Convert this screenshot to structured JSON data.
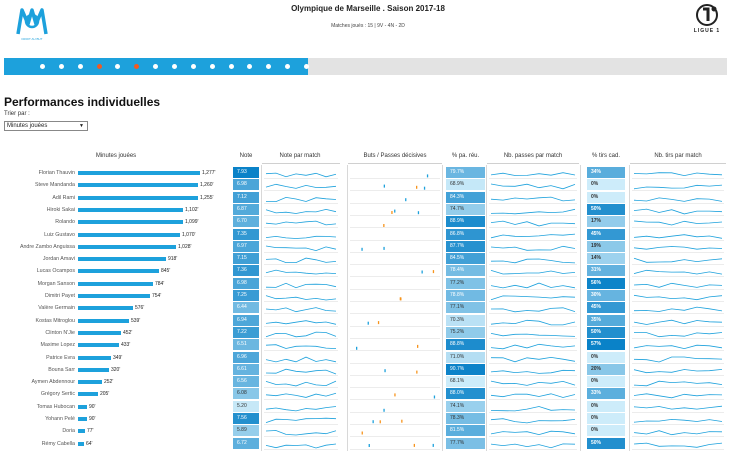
{
  "header": {
    "title": "Olympique de Marseille . Saison 2017-18",
    "subtitle": "Matches joués : 15 | 9V - 4N - 2D"
  },
  "logos": {
    "club_text": "DROIT AU BUT",
    "league_text": "LIGUE 1"
  },
  "slider": {
    "progress_fraction": 0.42,
    "dots": [
      "normal",
      "normal",
      "normal",
      "red",
      "normal",
      "red",
      "normal",
      "normal",
      "normal",
      "normal",
      "normal",
      "normal",
      "normal",
      "normal",
      "normal"
    ]
  },
  "section": {
    "title": "Performances individuelles",
    "sort_label": "Trier par :",
    "sort_value": "Minutes jouées"
  },
  "columns": {
    "minutes": "Minutes jouées",
    "note": "Note",
    "note_per_match": "Note par match",
    "goals_assists": "Buts / Passes décisives",
    "pass_pct": "% pa. réu.",
    "passes_per_match": "Nb. passes par match",
    "shots_pct": "% tirs cad.",
    "shots_per_match": "Nb. tirs par match"
  },
  "colors": {
    "accent": "#1da1dc",
    "slider_track": "#e3e3e3",
    "dot_red": "#f15a22"
  },
  "players": [
    {
      "name": "Florian Thauvin",
      "minutes": 1277,
      "minutes_label": "1,277'",
      "note": "7.93",
      "pass_pct": "79.7%",
      "pass_val": 79.7,
      "shots_pct": "34%",
      "shots_val": 34
    },
    {
      "name": "Steve Mandanda",
      "minutes": 1260,
      "minutes_label": "1,260'",
      "note": "6.98",
      "pass_pct": "68.9%",
      "pass_val": 68.9,
      "shots_pct": "0%",
      "shots_val": 0
    },
    {
      "name": "Adil Rami",
      "minutes": 1255,
      "minutes_label": "1,255'",
      "note": "7.12",
      "pass_pct": "84.3%",
      "pass_val": 84.3,
      "shots_pct": "0%",
      "shots_val": 0
    },
    {
      "name": "Hiroki Sakai",
      "minutes": 1102,
      "minutes_label": "1,102'",
      "note": "6.87",
      "pass_pct": "74.7%",
      "pass_val": 74.7,
      "shots_pct": "50%",
      "shots_val": 50
    },
    {
      "name": "Rolando",
      "minutes": 1099,
      "minutes_label": "1,099'",
      "note": "6.70",
      "pass_pct": "88.9%",
      "pass_val": 88.9,
      "shots_pct": "17%",
      "shots_val": 17
    },
    {
      "name": "Luiz Gustavo",
      "minutes": 1070,
      "minutes_label": "1,070'",
      "note": "7.35",
      "pass_pct": "86.8%",
      "pass_val": 86.8,
      "shots_pct": "45%",
      "shots_val": 45
    },
    {
      "name": "Andre Zambo Anguissa",
      "minutes": 1028,
      "minutes_label": "1,028'",
      "note": "6.97",
      "pass_pct": "87.7%",
      "pass_val": 87.7,
      "shots_pct": "19%",
      "shots_val": 19
    },
    {
      "name": "Jordan Amavi",
      "minutes": 918,
      "minutes_label": "918'",
      "note": "7.15",
      "pass_pct": "84.5%",
      "pass_val": 84.5,
      "shots_pct": "14%",
      "shots_val": 14
    },
    {
      "name": "Lucas Ocampos",
      "minutes": 845,
      "minutes_label": "845'",
      "note": "7.36",
      "pass_pct": "78.4%",
      "pass_val": 78.4,
      "shots_pct": "31%",
      "shots_val": 31
    },
    {
      "name": "Morgan Sanson",
      "minutes": 784,
      "minutes_label": "784'",
      "note": "6.98",
      "pass_pct": "77.2%",
      "pass_val": 77.2,
      "shots_pct": "56%",
      "shots_val": 56
    },
    {
      "name": "Dimitri Payet",
      "minutes": 754,
      "minutes_label": "754'",
      "note": "7.25",
      "pass_pct": "78.8%",
      "pass_val": 78.8,
      "shots_pct": "30%",
      "shots_val": 30
    },
    {
      "name": "Valère Germain",
      "minutes": 576,
      "minutes_label": "576'",
      "note": "6.44",
      "pass_pct": "77.1%",
      "pass_val": 77.1,
      "shots_pct": "45%",
      "shots_val": 45
    },
    {
      "name": "Kostas Mitroglou",
      "minutes": 539,
      "minutes_label": "539'",
      "note": "6.94",
      "pass_pct": "70.3%",
      "pass_val": 70.3,
      "shots_pct": "35%",
      "shots_val": 35
    },
    {
      "name": "Clinton N'Jie",
      "minutes": 452,
      "minutes_label": "452'",
      "note": "7.22",
      "pass_pct": "75.2%",
      "pass_val": 75.2,
      "shots_pct": "50%",
      "shots_val": 50
    },
    {
      "name": "Maxime Lopez",
      "minutes": 433,
      "minutes_label": "433'",
      "note": "6.51",
      "pass_pct": "88.8%",
      "pass_val": 88.8,
      "shots_pct": "57%",
      "shots_val": 57
    },
    {
      "name": "Patrice Evra",
      "minutes": 349,
      "minutes_label": "349'",
      "note": "6.96",
      "pass_pct": "71.0%",
      "pass_val": 71.0,
      "shots_pct": "0%",
      "shots_val": 0
    },
    {
      "name": "Bouna Sarr",
      "minutes": 320,
      "minutes_label": "320'",
      "note": "6.61",
      "pass_pct": "90.7%",
      "pass_val": 90.7,
      "shots_pct": "20%",
      "shots_val": 20
    },
    {
      "name": "Aymen Abdennour",
      "minutes": 252,
      "minutes_label": "252'",
      "note": "6.56",
      "pass_pct": "68.1%",
      "pass_val": 68.1,
      "shots_pct": "0%",
      "shots_val": 0
    },
    {
      "name": "Grégory Sertic",
      "minutes": 205,
      "minutes_label": "205'",
      "note": "6.08",
      "pass_pct": "88.0%",
      "pass_val": 88.0,
      "shots_pct": "33%",
      "shots_val": 33
    },
    {
      "name": "Tomas Hubocan",
      "minutes": 90,
      "minutes_label": "90'",
      "note": "5.20",
      "pass_pct": "74.1%",
      "pass_val": 74.1,
      "shots_pct": "0%",
      "shots_val": 0
    },
    {
      "name": "Yohann Pelé",
      "minutes": 90,
      "minutes_label": "90'",
      "note": "7.56",
      "pass_pct": "78.3%",
      "pass_val": 78.3,
      "shots_pct": "0%",
      "shots_val": 0
    },
    {
      "name": "Doria",
      "minutes": 77,
      "minutes_label": "77'",
      "note": "5.89",
      "pass_pct": "81.5%",
      "pass_val": 81.5,
      "shots_pct": "0%",
      "shots_val": 0
    },
    {
      "name": "Rémy Cabella",
      "minutes": 64,
      "minutes_label": "64'",
      "note": "6.72",
      "pass_pct": "77.7%",
      "pass_val": 77.7,
      "shots_pct": "50%",
      "shots_val": 50
    }
  ]
}
